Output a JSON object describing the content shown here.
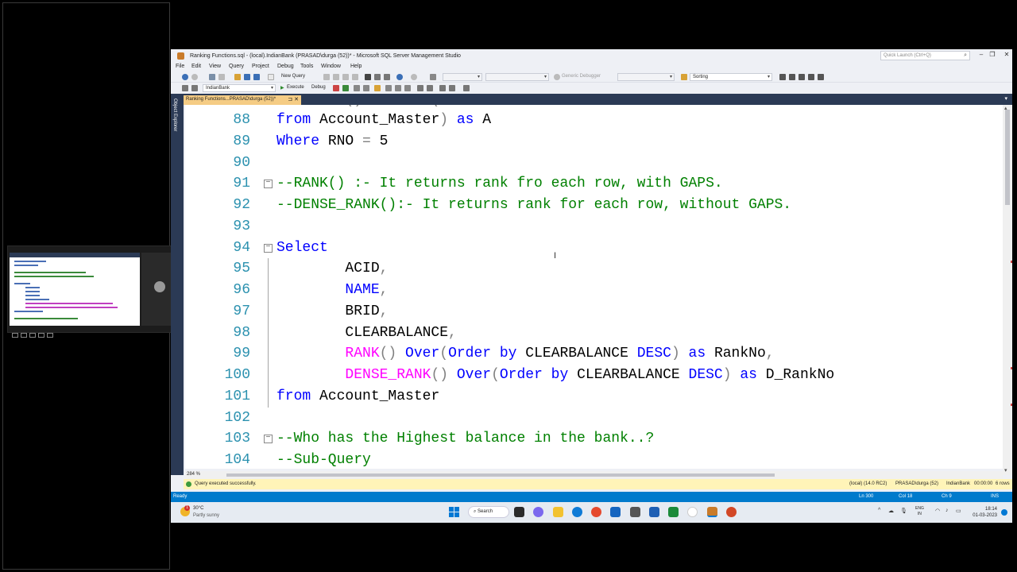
{
  "window": {
    "title": "Ranking Functions.sql - (local).IndianBank (PRASAD\\durga (52))* - Microsoft SQL Server Management Studio",
    "quick_launch_placeholder": "Quick Launch (Ctrl+Q)"
  },
  "menu": [
    "File",
    "Edit",
    "View",
    "Query",
    "Project",
    "Debug",
    "Tools",
    "Window",
    "Help"
  ],
  "toolbar": {
    "new_query": "New Query",
    "debugger": "Generic Debugger",
    "search_combo": "Sorting",
    "database": "IndianBank",
    "execute": "Execute",
    "debug": "Debug"
  },
  "side_panel": {
    "object_explorer": "Object Explorer"
  },
  "document_tab": {
    "label": "Ranking Functions...PRASAD\\durga (52))*",
    "pin": "⊐",
    "close": "✕"
  },
  "editor": {
    "lines": [
      {
        "no": "88",
        "tokens": [
          {
            "t": "from",
            "c": "kw"
          },
          {
            "t": " Account_Master",
            "c": ""
          },
          {
            "t": ")",
            "c": "gr"
          },
          {
            "t": " as",
            "c": "kw"
          },
          {
            "t": " A",
            "c": ""
          }
        ]
      },
      {
        "no": "89",
        "tokens": [
          {
            "t": "Where",
            "c": "kw"
          },
          {
            "t": " RNO ",
            "c": ""
          },
          {
            "t": "=",
            "c": "gr"
          },
          {
            "t": " 5",
            "c": ""
          }
        ]
      },
      {
        "no": "90",
        "tokens": []
      },
      {
        "no": "91",
        "fold": "start",
        "tokens": [
          {
            "t": "--RANK() :- It returns rank fro each row, with GAPS.",
            "c": "cm"
          }
        ]
      },
      {
        "no": "92",
        "tokens": [
          {
            "t": "--DENSE_RANK():- It returns rank for each row, without GAPS.",
            "c": "cm"
          }
        ]
      },
      {
        "no": "93",
        "tokens": []
      },
      {
        "no": "94",
        "fold": "start",
        "tokens": [
          {
            "t": "Select",
            "c": "kw"
          }
        ]
      },
      {
        "no": "95",
        "tokens": [
          {
            "t": "        ACID",
            "c": ""
          },
          {
            "t": ",",
            "c": "gr"
          }
        ]
      },
      {
        "no": "96",
        "tokens": [
          {
            "t": "        NAME",
            "c": "kw"
          },
          {
            "t": ",",
            "c": "gr"
          }
        ]
      },
      {
        "no": "97",
        "tokens": [
          {
            "t": "        BRID",
            "c": ""
          },
          {
            "t": ",",
            "c": "gr"
          }
        ]
      },
      {
        "no": "98",
        "tokens": [
          {
            "t": "        CLEARBALANCE",
            "c": ""
          },
          {
            "t": ",",
            "c": "gr"
          }
        ]
      },
      {
        "no": "99",
        "tokens": [
          {
            "t": "        RANK",
            "c": "fn"
          },
          {
            "t": "()",
            "c": "gr"
          },
          {
            "t": " Over",
            "c": "kw"
          },
          {
            "t": "(",
            "c": "gr"
          },
          {
            "t": "Order by",
            "c": "kw"
          },
          {
            "t": " CLEARBALANCE ",
            "c": ""
          },
          {
            "t": "DESC",
            "c": "kw"
          },
          {
            "t": ")",
            "c": "gr"
          },
          {
            "t": " as",
            "c": "kw"
          },
          {
            "t": " RankNo",
            "c": ""
          },
          {
            "t": ",",
            "c": "gr"
          }
        ]
      },
      {
        "no": "100",
        "tokens": [
          {
            "t": "        DENSE_RANK",
            "c": "fn"
          },
          {
            "t": "()",
            "c": "gr"
          },
          {
            "t": " Over",
            "c": "kw"
          },
          {
            "t": "(",
            "c": "gr"
          },
          {
            "t": "Order by",
            "c": "kw"
          },
          {
            "t": " CLEARBALANCE ",
            "c": ""
          },
          {
            "t": "DESC",
            "c": "kw"
          },
          {
            "t": ")",
            "c": "gr"
          },
          {
            "t": " as",
            "c": "kw"
          },
          {
            "t": " D_RankNo",
            "c": ""
          }
        ]
      },
      {
        "no": "101",
        "tokens": [
          {
            "t": "from",
            "c": "kw"
          },
          {
            "t": " Account_Master",
            "c": ""
          }
        ]
      },
      {
        "no": "102",
        "tokens": []
      },
      {
        "no": "103",
        "fold": "start",
        "tokens": [
          {
            "t": "--Who has the Highest balance in the bank..?",
            "c": "cm"
          }
        ]
      },
      {
        "no": "104",
        "tokens": [
          {
            "t": "--Sub-Query",
            "c": "cm"
          }
        ]
      }
    ]
  },
  "zoom": "284 %",
  "query_status": {
    "message": "Query executed successfully.",
    "server": "(local) (14.0 RC2)",
    "user": "PRASAD\\durga (52)",
    "database": "IndianBank",
    "elapsed": "00:00:00",
    "rows": "6 rows"
  },
  "status_bar": {
    "ready": "Ready",
    "ln": "Ln 300",
    "col": "Col 18",
    "ch": "Ch 9",
    "mode": "INS"
  },
  "taskbar": {
    "weather_temp": "30°C",
    "weather_desc": "Partly sunny",
    "weather_badge": "1",
    "search": "Search",
    "lang_top": "ENG",
    "lang_bottom": "IN",
    "time": "18:14",
    "date": "01-03-2023"
  },
  "colors": {
    "keyword": "#0000ff",
    "function": "#ff00ff",
    "comment": "#008000",
    "status_bar": "#007acc",
    "tab_active": "#f5cc84"
  }
}
